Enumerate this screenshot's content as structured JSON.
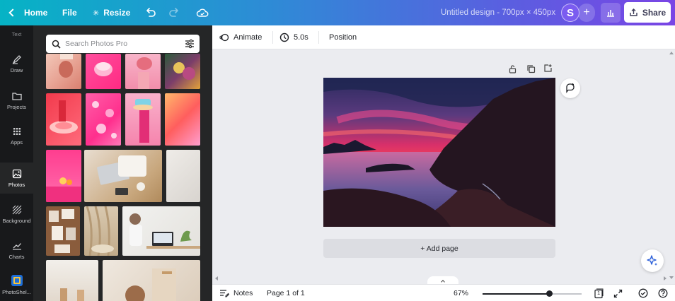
{
  "topbar": {
    "home_label": "Home",
    "file_label": "File",
    "resize_label": "Resize",
    "title": "Untitled design - 700px × 450px",
    "avatar_initial": "S",
    "share_label": "Share"
  },
  "rail": {
    "top_cut_label": "Text",
    "items": [
      {
        "label": "Draw",
        "icon": "draw-icon"
      },
      {
        "label": "Projects",
        "icon": "folder-icon"
      },
      {
        "label": "Apps",
        "icon": "apps-grid-icon"
      },
      {
        "label": "Photos",
        "icon": "photo-icon",
        "active": true
      },
      {
        "label": "Background",
        "icon": "background-pattern-icon"
      },
      {
        "label": "Charts",
        "icon": "chart-line-icon"
      },
      {
        "label": "PhotoShel...",
        "icon": "photoshelter-app-icon"
      }
    ]
  },
  "photos_panel": {
    "search_placeholder": "Search Photos Pro"
  },
  "context_toolbar": {
    "animate_label": "Animate",
    "duration_label": "5.0s",
    "position_label": "Position"
  },
  "canvas": {
    "add_page_label": "+ Add page"
  },
  "bottombar": {
    "notes_label": "Notes",
    "page_indicator": "Page 1 of 1",
    "zoom_label": "67%",
    "zoom_fraction": 0.67,
    "page_count": "1"
  }
}
